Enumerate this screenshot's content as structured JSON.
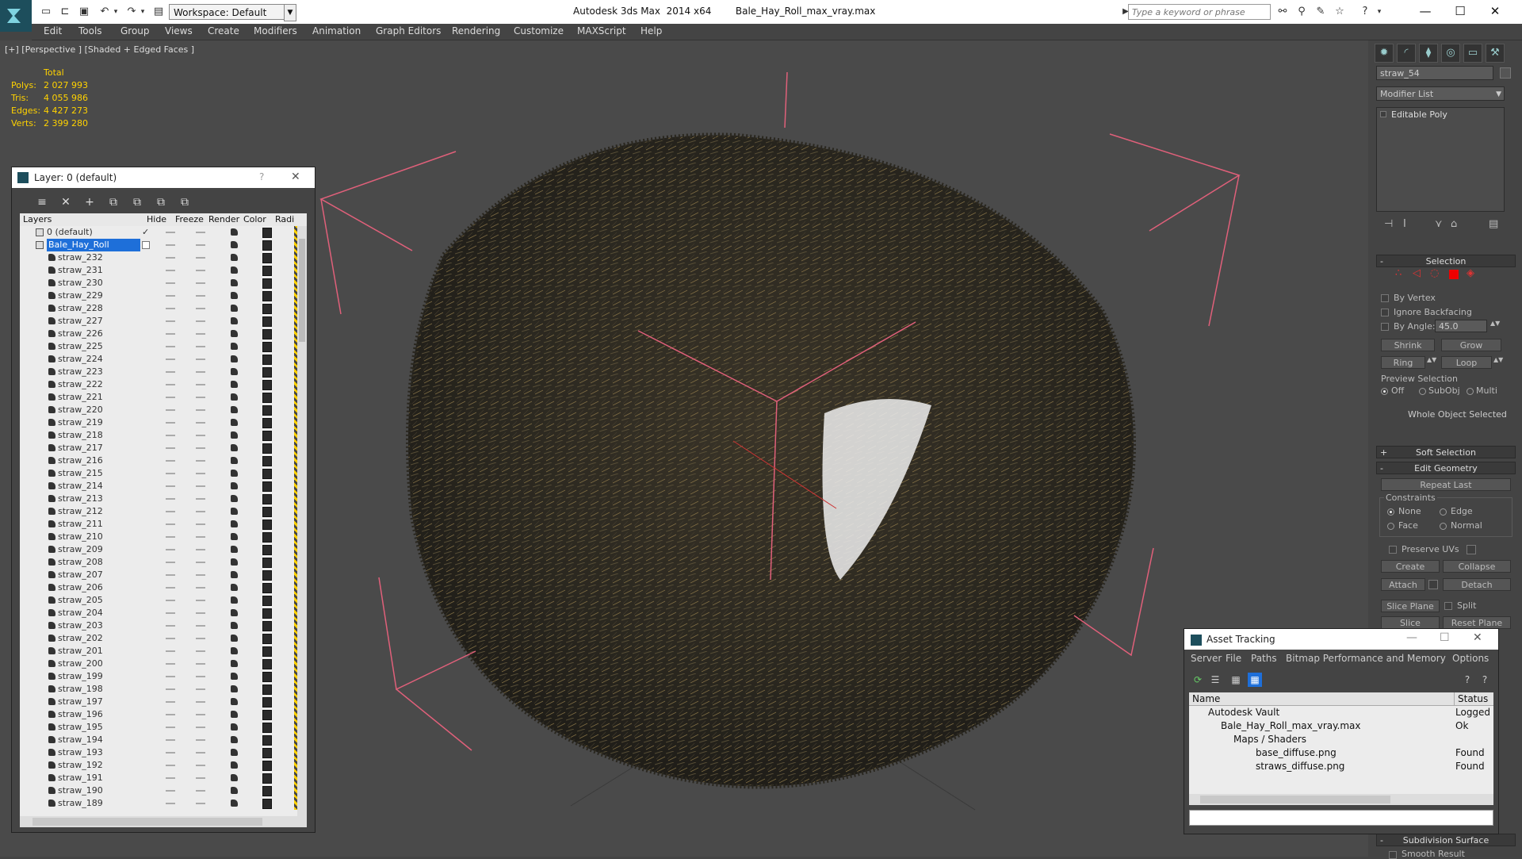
{
  "titlebar": {
    "app_title": "Autodesk 3ds Max  2014 x64",
    "file_name": "Bale_Hay_Roll_max_vray.max",
    "workspace": "Workspace: Default",
    "search_placeholder": "Type a keyword or phrase"
  },
  "menu": [
    "Edit",
    "Tools",
    "Group",
    "Views",
    "Create",
    "Modifiers",
    "Animation",
    "Graph Editors",
    "Rendering",
    "Customize",
    "MAXScript",
    "Help"
  ],
  "viewport": {
    "label": "[+] [Perspective ] [Shaded + Edged Faces ]",
    "stats_header": "Total",
    "stats": [
      {
        "key": "Polys:",
        "value": "2 027 993"
      },
      {
        "key": "Tris:",
        "value": "4 055 986"
      },
      {
        "key": "Edges:",
        "value": "4 427 273"
      },
      {
        "key": "Verts:",
        "value": "2 399 280"
      }
    ]
  },
  "layer_panel": {
    "title": "Layer: 0 (default)",
    "help": "?",
    "columns": [
      "Layers",
      "Hide",
      "Freeze",
      "Render",
      "Color",
      "Radi"
    ],
    "default_layer": "0 (default)",
    "selected_layer": "Bale_Hay_Roll",
    "objects": [
      "straw_232",
      "straw_231",
      "straw_230",
      "straw_229",
      "straw_228",
      "straw_227",
      "straw_226",
      "straw_225",
      "straw_224",
      "straw_223",
      "straw_222",
      "straw_221",
      "straw_220",
      "straw_219",
      "straw_218",
      "straw_217",
      "straw_216",
      "straw_215",
      "straw_214",
      "straw_213",
      "straw_212",
      "straw_211",
      "straw_210",
      "straw_209",
      "straw_208",
      "straw_207",
      "straw_206",
      "straw_205",
      "straw_204",
      "straw_203",
      "straw_202",
      "straw_201",
      "straw_200",
      "straw_199",
      "straw_198",
      "straw_197",
      "straw_196",
      "straw_195",
      "straw_194",
      "straw_193",
      "straw_192",
      "straw_191",
      "straw_190",
      "straw_189"
    ]
  },
  "command_panel": {
    "object_name": "straw_54",
    "modifier_list": "Modifier List",
    "stack_item": "Editable Poly",
    "selection": {
      "title": "Selection",
      "by_vertex": "By Vertex",
      "ignore_backfacing": "Ignore Backfacing",
      "by_angle": "By Angle:",
      "angle_value": "45.0",
      "shrink": "Shrink",
      "grow": "Grow",
      "ring": "Ring",
      "loop": "Loop",
      "preview_selection": "Preview Selection",
      "off": "Off",
      "subobj": "SubObj",
      "multi": "Multi",
      "status": "Whole Object Selected"
    },
    "soft_selection": "Soft Selection",
    "edit_geometry": {
      "title": "Edit Geometry",
      "repeat_last": "Repeat Last",
      "constraints": "Constraints",
      "none": "None",
      "edge": "Edge",
      "face": "Face",
      "normal": "Normal",
      "preserve_uvs": "Preserve UVs",
      "create": "Create",
      "collapse": "Collapse",
      "attach": "Attach",
      "detach": "Detach",
      "slice_plane": "Slice Plane",
      "split": "Split",
      "slice": "Slice",
      "reset_plane": "Reset Plane"
    },
    "subdivision_surface": "Subdivision Surface",
    "smooth_result": "Smooth Result"
  },
  "asset_tracking": {
    "title": "Asset Tracking",
    "menu": [
      "Server",
      "File",
      "Paths",
      "Bitmap Performance and Memory",
      "Options"
    ],
    "col_name": "Name",
    "col_status": "Status",
    "rows": [
      {
        "name": "Autodesk Vault",
        "status": "Logged O"
      },
      {
        "name": "Bale_Hay_Roll_max_vray.max",
        "status": "Ok"
      },
      {
        "name": "Maps / Shaders",
        "status": ""
      },
      {
        "name": "base_diffuse.png",
        "status": "Found"
      },
      {
        "name": "straws_diffuse.png",
        "status": "Found"
      }
    ]
  },
  "colors": {
    "stats_text": "#ffd200",
    "selection_highlight": "#1e6fd9",
    "bounding_box": "#e0607a",
    "hay_dark": "#2d2a22",
    "hay_light": "#b59b5e"
  }
}
